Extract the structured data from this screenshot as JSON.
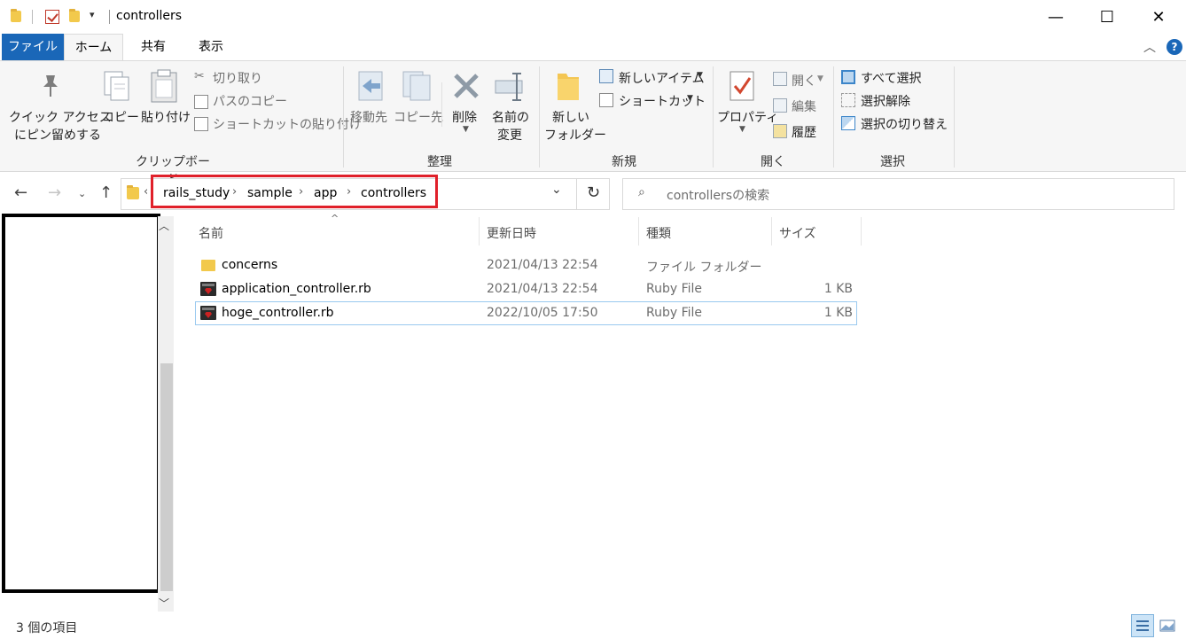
{
  "window": {
    "title": "controllers",
    "minimize": "—",
    "maximize": "☐",
    "close": "✕"
  },
  "tabs": {
    "file": "ファイル",
    "home": "ホーム",
    "share": "共有",
    "view": "表示"
  },
  "ribbon": {
    "clipboard": {
      "label": "クリップボード",
      "pin_line1": "クイック アクセス",
      "pin_line2": "にピン留めする",
      "copy": "コピー",
      "paste": "貼り付け",
      "cut": "切り取り",
      "copy_path": "パスのコピー",
      "paste_shortcut": "ショートカットの貼り付け"
    },
    "organize": {
      "label": "整理",
      "move_to": "移動先",
      "copy_to": "コピー先",
      "delete": "削除",
      "rename_line1": "名前の",
      "rename_line2": "変更"
    },
    "new": {
      "label": "新規",
      "new_folder_line1": "新しい",
      "new_folder_line2": "フォルダー",
      "new_item": "新しいアイテム",
      "shortcut": "ショートカット"
    },
    "open": {
      "label": "開く",
      "properties": "プロパティ",
      "open": "開く",
      "edit": "編集",
      "history": "履歴"
    },
    "select": {
      "label": "選択",
      "select_all": "すべて選択",
      "select_none": "選択解除",
      "invert": "選択の切り替え"
    }
  },
  "address": {
    "crumbs": [
      "rails_study",
      "sample",
      "app",
      "controllers"
    ],
    "search_placeholder": "controllersの検索"
  },
  "columns": {
    "name": "名前",
    "date": "更新日時",
    "type": "種類",
    "size": "サイズ"
  },
  "files": [
    {
      "name": "concerns",
      "date": "2021/04/13 22:54",
      "type": "ファイル フォルダー",
      "size": "",
      "icon": "folder-icon"
    },
    {
      "name": "application_controller.rb",
      "date": "2021/04/13 22:54",
      "type": "Ruby File",
      "size": "1 KB",
      "icon": "ruby-file-icon"
    },
    {
      "name": "hoge_controller.rb",
      "date": "2022/10/05 17:50",
      "type": "Ruby File",
      "size": "1 KB",
      "icon": "ruby-file-icon"
    }
  ],
  "status": {
    "item_count": "3 個の項目"
  },
  "colors": {
    "accent": "#1a67b8",
    "highlight_box": "#e0202a",
    "selection_border": "#99c9ef"
  }
}
